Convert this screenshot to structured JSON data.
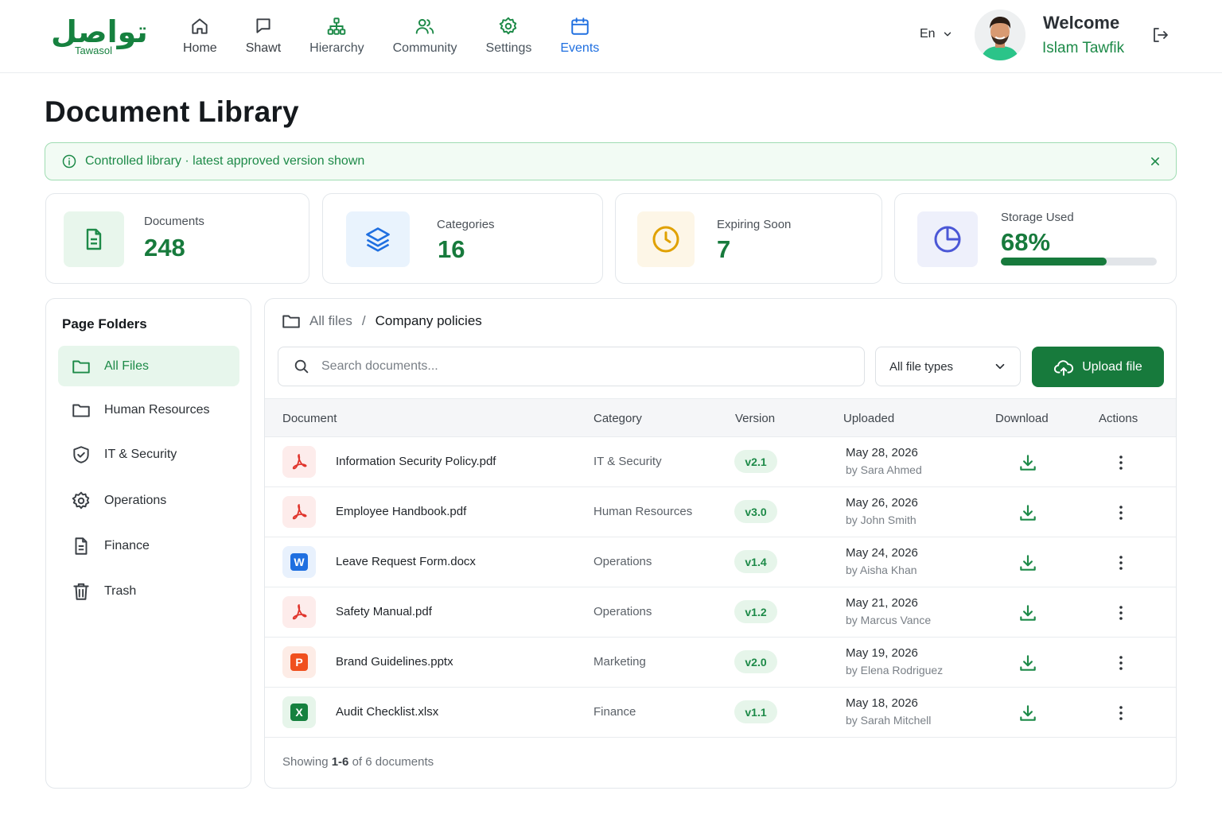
{
  "brand": {
    "name_ar": "تواصل",
    "name_en": "Tawasol",
    "color": "#16813f"
  },
  "nav": [
    {
      "label": "Home",
      "icon": "home-icon"
    },
    {
      "label": "Shawt",
      "icon": "chat-icon"
    },
    {
      "label": "Hierarchy",
      "icon": "hierarchy-icon"
    },
    {
      "label": "Community",
      "icon": "users-icon"
    },
    {
      "label": "Settings",
      "icon": "gear-icon"
    },
    {
      "label": "Events",
      "icon": "calendar-icon"
    }
  ],
  "header": {
    "language": "En",
    "welcome": "Welcome",
    "user_name": "Islam Tawfik"
  },
  "page": {
    "title": "Document Library"
  },
  "notice": {
    "text": "Controlled library · latest approved version shown"
  },
  "stats": {
    "documents": {
      "label": "Documents",
      "value": "248"
    },
    "categories": {
      "label": "Categories",
      "value": "16"
    },
    "expiring": {
      "label": "Expiring Soon",
      "value": "7"
    },
    "storage": {
      "label": "Storage Used",
      "value": "68%",
      "fraction": 0.68
    }
  },
  "folders": {
    "title": "Page Folders",
    "items": [
      {
        "label": "All Files",
        "icon": "folder-icon",
        "active": true
      },
      {
        "label": "Human Resources",
        "icon": "folder-icon"
      },
      {
        "label": "IT & Security",
        "icon": "shield-icon"
      },
      {
        "label": "Operations",
        "icon": "gear-icon"
      },
      {
        "label": "Finance",
        "icon": "document-icon"
      },
      {
        "label": "Trash",
        "icon": "trash-icon"
      }
    ]
  },
  "breadcrumb": {
    "root": "All files",
    "separator": "/",
    "current": "Company policies"
  },
  "search": {
    "placeholder": "Search documents..."
  },
  "filter": {
    "selected": "All file types"
  },
  "upload": {
    "label": "Upload file"
  },
  "table": {
    "columns": {
      "document": "Document",
      "category": "Category",
      "version": "Version",
      "uploaded": "Uploaded",
      "download": "Download",
      "actions": "Actions"
    },
    "rows": [
      {
        "name": "Information Security Policy.pdf",
        "type": "pdf",
        "category": "IT & Security",
        "version": "v2.1",
        "date": "May 28, 2026",
        "by": "by Sara Ahmed"
      },
      {
        "name": "Employee Handbook.pdf",
        "type": "pdf",
        "category": "Human Resources",
        "version": "v3.0",
        "date": "May 26, 2026",
        "by": "by John Smith"
      },
      {
        "name": "Leave Request Form.docx",
        "type": "docx",
        "category": "Operations",
        "version": "v1.4",
        "date": "May 24, 2026",
        "by": "by Aisha Khan"
      },
      {
        "name": "Safety Manual.pdf",
        "type": "pdf",
        "category": "Operations",
        "version": "v1.2",
        "date": "May 21, 2026",
        "by": "by Marcus Vance"
      },
      {
        "name": "Brand Guidelines.pptx",
        "type": "pptx",
        "category": "Marketing",
        "version": "v2.0",
        "date": "May 19, 2026",
        "by": "by Elena Rodriguez"
      },
      {
        "name": "Audit Checklist.xlsx",
        "type": "xlsx",
        "category": "Finance",
        "version": "v1.1",
        "date": "May 18, 2026",
        "by": "by Sarah Mitchell"
      }
    ]
  },
  "footer": {
    "prefix": "Showing",
    "range": "1-6",
    "suffix": "of 6 documents"
  },
  "colors": {
    "primary": "#177a3c",
    "accent_blue": "#1f6fe0",
    "warning": "#e0a100",
    "storage_bar": "#177a3c"
  }
}
